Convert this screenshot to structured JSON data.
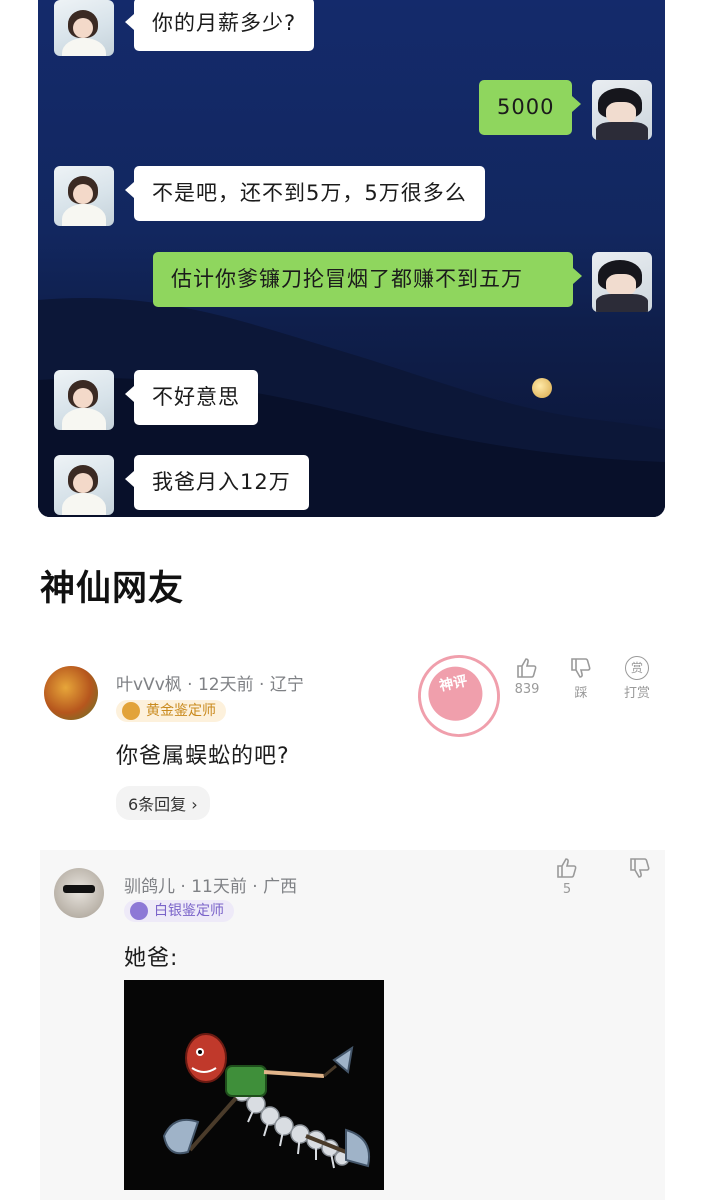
{
  "chat": {
    "messages": [
      {
        "side": "left",
        "text": "你的月薪多少?"
      },
      {
        "side": "right",
        "text": "5000"
      },
      {
        "side": "left",
        "text": "不是吧，还不到5万，5万很多么"
      },
      {
        "side": "right",
        "text": "估计你爹镰刀抡冒烟了都赚不到五万"
      },
      {
        "side": "left",
        "text": "不好意思"
      },
      {
        "side": "left",
        "text": "我爸月入12万"
      }
    ]
  },
  "section_title": "神仙网友",
  "comments": [
    {
      "username": "叶vVv枫",
      "time": "12天前",
      "location": "辽宁",
      "badge": "黄金鉴定师",
      "text": "你爸属蜈蚣的吧?",
      "replies": "6条回复",
      "like_count": "839",
      "dislike_label": "踩",
      "reward_label": "打赏",
      "reward_icon_text": "赏",
      "stamp_text": "神评"
    },
    {
      "username": "驯鸽儿",
      "time": "11天前",
      "location": "广西",
      "badge": "白银鉴定师",
      "text": "她爸:",
      "like_count": "5"
    }
  ],
  "colors": {
    "chat_bg": "#142a6b",
    "bubble_green": "#8fd65e",
    "gold_badge": "#c98a1e",
    "silver_badge": "#7a63c9"
  }
}
